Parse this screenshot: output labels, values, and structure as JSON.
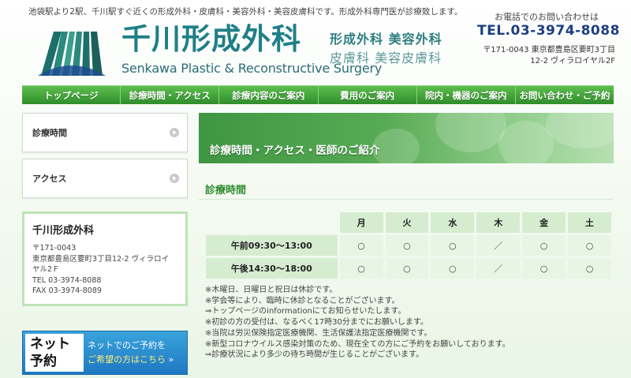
{
  "header": {
    "tagline": "池袋駅より2駅、千川駅すぐ近くの形成外科・皮膚科・美容外科・美容皮膚科です。形成外科専門医が診療致します。",
    "logo_jp": "千川形成外科",
    "logo_en": "Senkawa Plastic & Reconstructive Surgery",
    "logo_sub_1": "形成外科 美容外科",
    "logo_sub_2": "皮膚科 美容皮膚科",
    "phone_note": "お電話でのお問い合わせは",
    "phone": "TEL.03-3974-8088",
    "address_1": "〒171-0043 東京都豊島区要町3丁目",
    "address_2": "12-2 ヴィラロイヤル2F"
  },
  "nav": {
    "items": [
      {
        "label": "トップページ"
      },
      {
        "label": "診療時間・アクセス"
      },
      {
        "label": "診療内容のご案内"
      },
      {
        "label": "費用のご案内"
      },
      {
        "label": "院内・機器のご案内"
      },
      {
        "label": "お問い合わせ・ご予約"
      }
    ]
  },
  "sidebar": {
    "items": [
      {
        "label": "診療時間"
      },
      {
        "label": "アクセス"
      }
    ],
    "clinic": {
      "name": "千川形成外科",
      "postal": "〒171-0043",
      "address_1": "東京都豊島区要町3丁目12-2 ヴィラロイ",
      "address_2": "ヤル2Ｆ",
      "tel": "TEL 03-3974-8088",
      "fax": "FAX 03-3974-8089"
    },
    "reserve": {
      "left_1": "ネット",
      "left_2": "予約",
      "right_1": "ネットでのご予約を",
      "right_2": "ご希望の方はこちら"
    }
  },
  "main": {
    "banner_title": "診療時間・アクセス・医師のご紹介",
    "section_title": "診療時間",
    "schedule": {
      "days": [
        "月",
        "火",
        "水",
        "木",
        "金",
        "土"
      ],
      "rows": [
        {
          "label": "午前09:30～13:00",
          "marks": [
            "○",
            "○",
            "○",
            "／",
            "○",
            "○"
          ]
        },
        {
          "label": "午後14:30～18:00",
          "marks": [
            "○",
            "○",
            "○",
            "／",
            "○",
            "○"
          ]
        }
      ]
    },
    "notes": [
      "※木曜日、日曜日と祝日は休診です。",
      "※学会等により、臨時に休診となることがございます。",
      "⇒トップページのinformationにてお知らせいたします。",
      "※初診の方の受付は、なるべく17時30分までにお願いします。",
      "※当院は労災保険指定医療機関、生活保護法指定医療機関です。",
      "※新型コロナウイルス感染対策のため、現在全ての方にご予約をお願いしております。",
      "⇒診療状況により多少の待ち時間が生じることがございます。"
    ]
  },
  "colors": {
    "nav_green": "#3a9a34",
    "title_teal": "#1f7f87",
    "phone_blue": "#1d3f82",
    "section_green": "#2f8a2f"
  }
}
